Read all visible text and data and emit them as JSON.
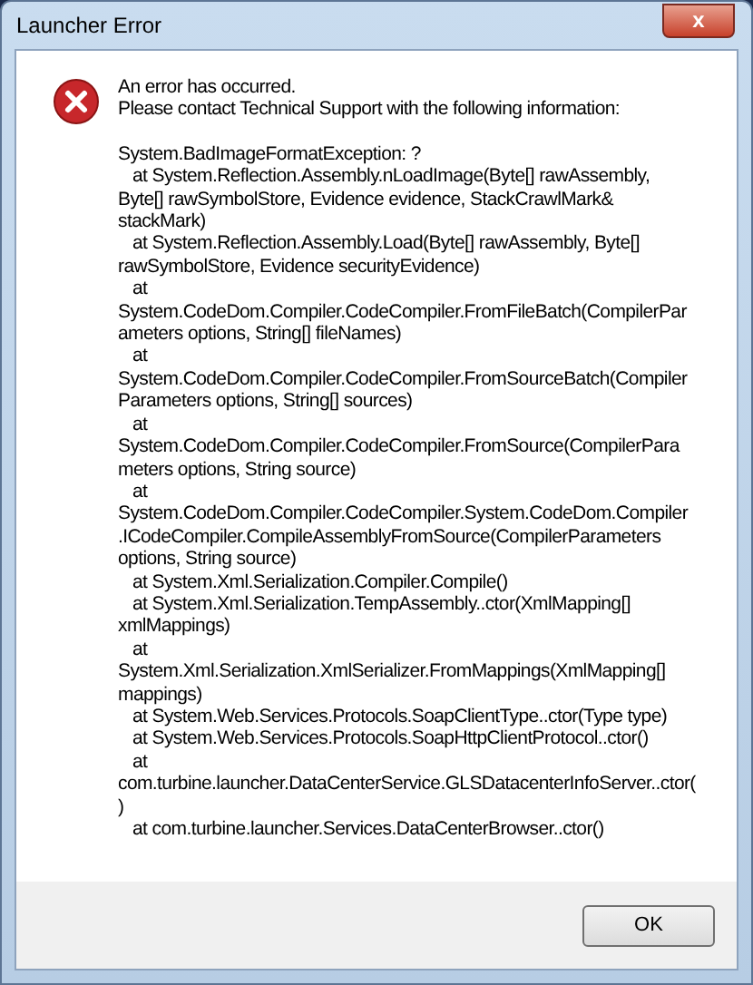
{
  "window": {
    "title": "Launcher Error",
    "close_label": "x"
  },
  "message": [
    "An error has occurred.",
    "Please contact Technical Support with the following information:"
  ],
  "details": [
    {
      "text": "System.BadImageFormatException: ?",
      "kind": "plain"
    },
    {
      "text": "at System.Reflection.Assembly.nLoadImage(Byte[] rawAssembly,",
      "kind": "indented"
    },
    {
      "text": "Byte[] rawSymbolStore, Evidence evidence, StackCrawlMark&",
      "kind": "plain"
    },
    {
      "text": "stackMark)",
      "kind": "plain"
    },
    {
      "text": "at System.Reflection.Assembly.Load(Byte[] rawAssembly, Byte[]",
      "kind": "indented"
    },
    {
      "text": "rawSymbolStore, Evidence securityEvidence)",
      "kind": "plain"
    },
    {
      "text": "at",
      "kind": "indented"
    },
    {
      "text": "System.CodeDom.Compiler.CodeCompiler.FromFileBatch(CompilerPar",
      "kind": "plain"
    },
    {
      "text": "ameters options, String[] fileNames)",
      "kind": "plain"
    },
    {
      "text": "at",
      "kind": "indented"
    },
    {
      "text": "System.CodeDom.Compiler.CodeCompiler.FromSourceBatch(Compiler",
      "kind": "plain"
    },
    {
      "text": "Parameters options, String[] sources)",
      "kind": "plain"
    },
    {
      "text": "at",
      "kind": "indented"
    },
    {
      "text": "System.CodeDom.Compiler.CodeCompiler.FromSource(CompilerPara",
      "kind": "plain"
    },
    {
      "text": "meters options, String source)",
      "kind": "plain"
    },
    {
      "text": "at",
      "kind": "indented"
    },
    {
      "text": "System.CodeDom.Compiler.CodeCompiler.System.CodeDom.Compiler",
      "kind": "plain"
    },
    {
      "text": ".ICodeCompiler.CompileAssemblyFromSource(CompilerParameters",
      "kind": "plain"
    },
    {
      "text": "options, String source)",
      "kind": "plain"
    },
    {
      "text": "at System.Xml.Serialization.Compiler.Compile()",
      "kind": "indented"
    },
    {
      "text": "at System.Xml.Serialization.TempAssembly..ctor(XmlMapping[]",
      "kind": "indented"
    },
    {
      "text": "xmlMappings)",
      "kind": "plain"
    },
    {
      "text": "at",
      "kind": "indented"
    },
    {
      "text": "System.Xml.Serialization.XmlSerializer.FromMappings(XmlMapping[]",
      "kind": "plain"
    },
    {
      "text": "mappings)",
      "kind": "plain"
    },
    {
      "text": "at System.Web.Services.Protocols.SoapClientType..ctor(Type type)",
      "kind": "indented"
    },
    {
      "text": "at System.Web.Services.Protocols.SoapHttpClientProtocol..ctor()",
      "kind": "indented"
    },
    {
      "text": "at",
      "kind": "indented"
    },
    {
      "text": "com.turbine.launcher.DataCenterService.GLSDatacenterInfoServer..ctor(",
      "kind": "plain"
    },
    {
      "text": ")",
      "kind": "plain"
    },
    {
      "text": "at com.turbine.launcher.Services.DataCenterBrowser..ctor()",
      "kind": "indented"
    }
  ],
  "buttons": [
    "OK"
  ]
}
